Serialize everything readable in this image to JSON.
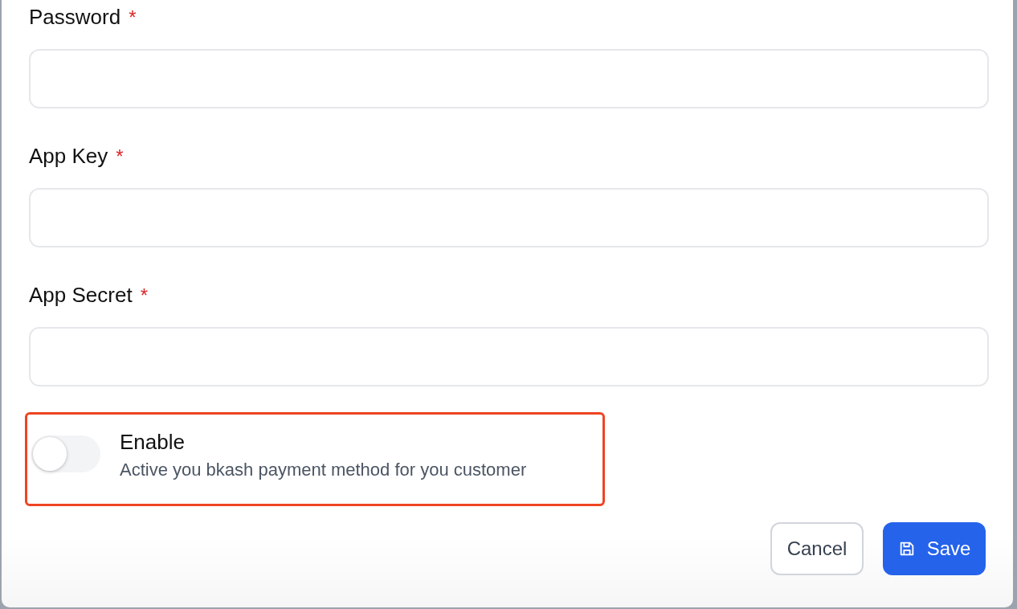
{
  "fields": [
    {
      "label": "Password",
      "required_mark": "*"
    },
    {
      "label": "App Key",
      "required_mark": "*"
    },
    {
      "label": "App Secret",
      "required_mark": "*"
    }
  ],
  "toggle": {
    "title": "Enable",
    "description": "Active you bkash payment method for you customer",
    "on": false,
    "highlighted": true
  },
  "buttons": [
    {
      "kind": "secondary",
      "label": "Cancel"
    },
    {
      "kind": "primary",
      "label": "Save"
    }
  ]
}
